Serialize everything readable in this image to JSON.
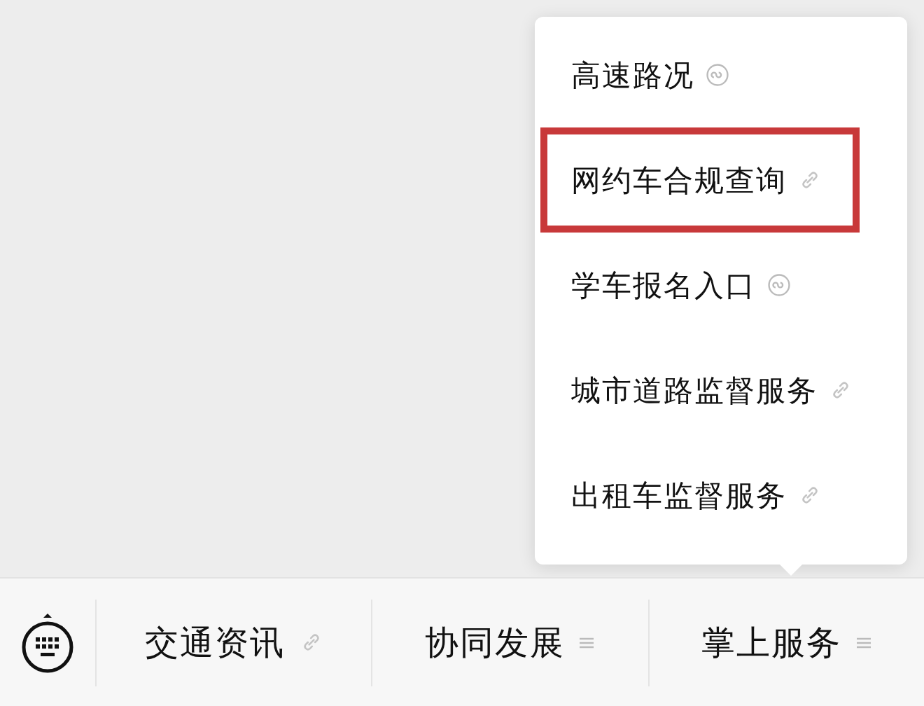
{
  "bottom_menu": {
    "items": [
      {
        "label": "交通资讯",
        "kind": "link"
      },
      {
        "label": "协同发展",
        "kind": "menu"
      },
      {
        "label": "掌上服务",
        "kind": "menu",
        "submenu": [
          {
            "label": "高速路况",
            "kind": "mini-program",
            "highlighted": false
          },
          {
            "label": "网约车合规查询",
            "kind": "link",
            "highlighted": true
          },
          {
            "label": "学车报名入口",
            "kind": "mini-program",
            "highlighted": false
          },
          {
            "label": "城市道路监督服务",
            "kind": "link",
            "highlighted": false
          },
          {
            "label": "出租车监督服务",
            "kind": "link",
            "highlighted": false
          }
        ]
      }
    ]
  }
}
